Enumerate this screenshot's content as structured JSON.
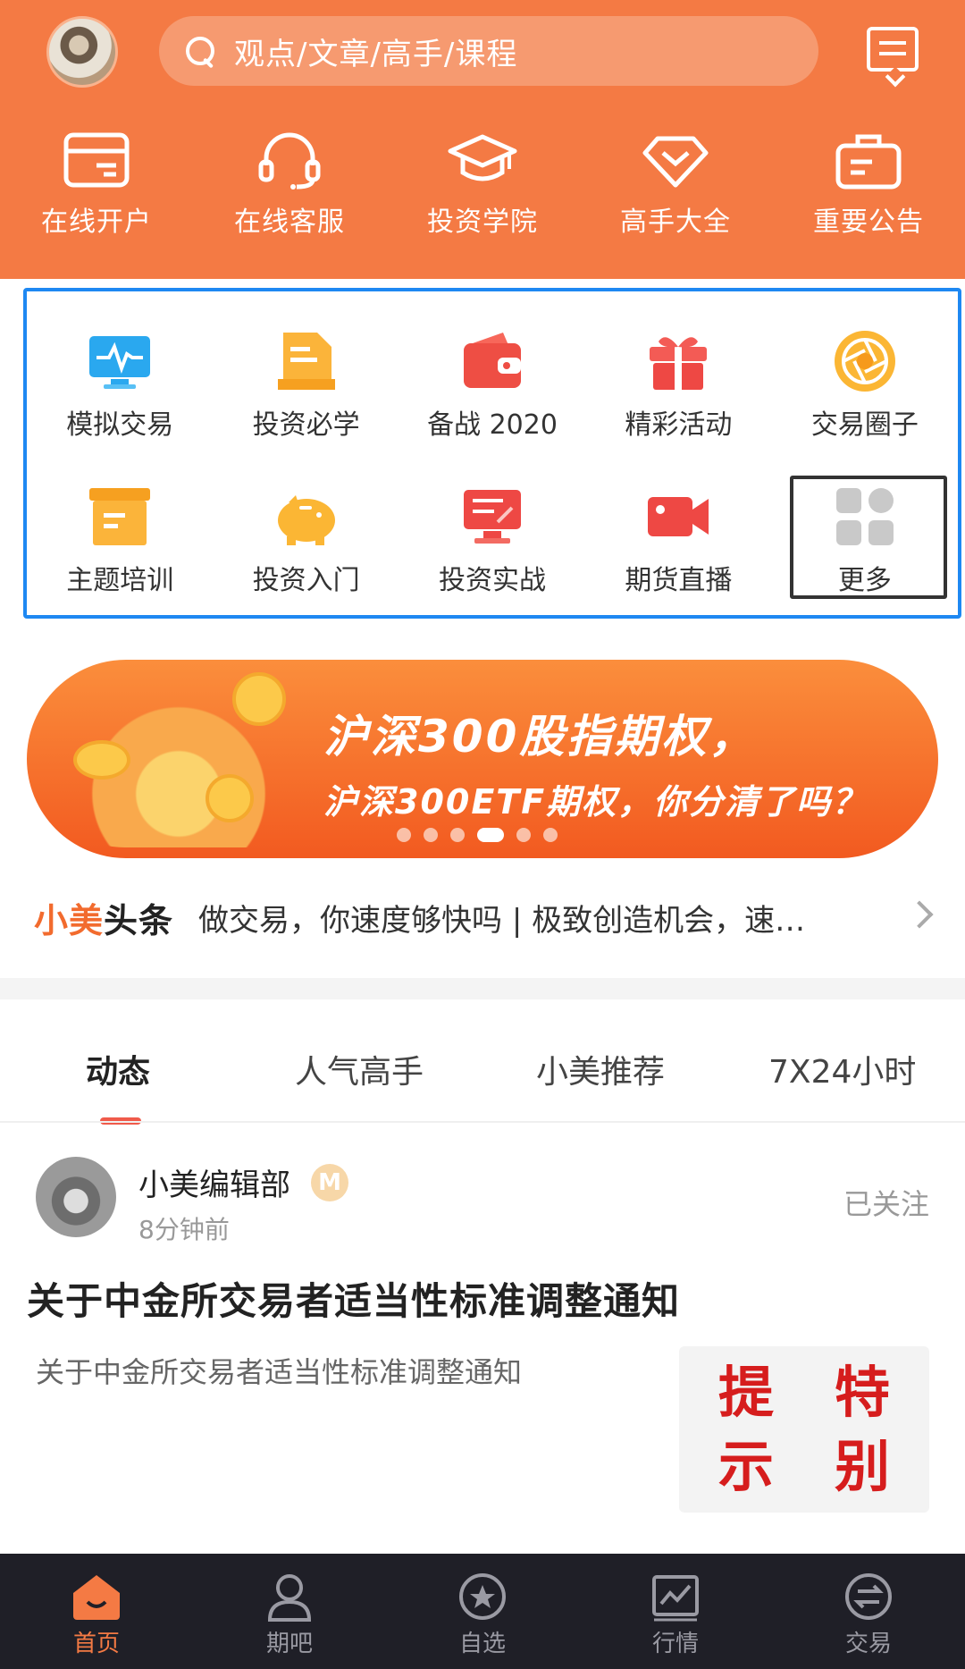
{
  "header": {
    "search_placeholder": "观点/文章/高手/课程",
    "quick_links": [
      {
        "label": "在线开户",
        "icon": "card-icon"
      },
      {
        "label": "在线客服",
        "icon": "headset-icon"
      },
      {
        "label": "投资学院",
        "icon": "graduation-cap-icon"
      },
      {
        "label": "高手大全",
        "icon": "diamond-icon"
      },
      {
        "label": "重要公告",
        "icon": "briefcase-icon"
      }
    ]
  },
  "grid": {
    "row1": [
      {
        "label": "模拟交易",
        "icon": "monitor-chart-icon"
      },
      {
        "label": "投资必学",
        "icon": "document-icon"
      },
      {
        "label": "备战 2020",
        "icon": "wallet-icon"
      },
      {
        "label": "精彩活动",
        "icon": "gift-icon"
      },
      {
        "label": "交易圈子",
        "icon": "aperture-icon"
      }
    ],
    "row2": [
      {
        "label": "主题培训",
        "icon": "box-icon"
      },
      {
        "label": "投资入门",
        "icon": "piggy-bank-icon"
      },
      {
        "label": "投资实战",
        "icon": "screen-icon"
      },
      {
        "label": "期货直播",
        "icon": "video-camera-icon"
      },
      {
        "label": "更多",
        "icon": "grid-more-icon"
      }
    ]
  },
  "banner": {
    "title": "沪深300股指期权，",
    "subtitle": "沪深300ETF期权，你分清了吗？",
    "active_dot": 3
  },
  "headline": {
    "brand_accent": "小美",
    "brand_rest": "头条",
    "text": "做交易，你速度够快吗 | 极致创造机会，速…"
  },
  "tabs": [
    "动态",
    "人气高手",
    "小美推荐",
    "7X24小时"
  ],
  "post": {
    "author": "小美编辑部",
    "badge": "M",
    "time": "8分钟前",
    "follow": "已关注",
    "title": "关于中金所交易者适当性标准调整通知",
    "summary": "关于中金所交易者适当性标准调整通知",
    "thumb_chars": [
      "提",
      "特",
      "示",
      "别"
    ]
  },
  "bottom_nav": [
    {
      "label": "首页",
      "icon": "home-icon"
    },
    {
      "label": "期吧",
      "icon": "person-icon"
    },
    {
      "label": "自选",
      "icon": "star-icon"
    },
    {
      "label": "行情",
      "icon": "chart-icon"
    },
    {
      "label": "交易",
      "icon": "exchange-icon"
    }
  ],
  "colors": {
    "brand_orange": "#f47a44",
    "highlight_border": "#1e88f2",
    "nav_bg": "#1f1f27",
    "tab_underline": "#f05a4a"
  }
}
